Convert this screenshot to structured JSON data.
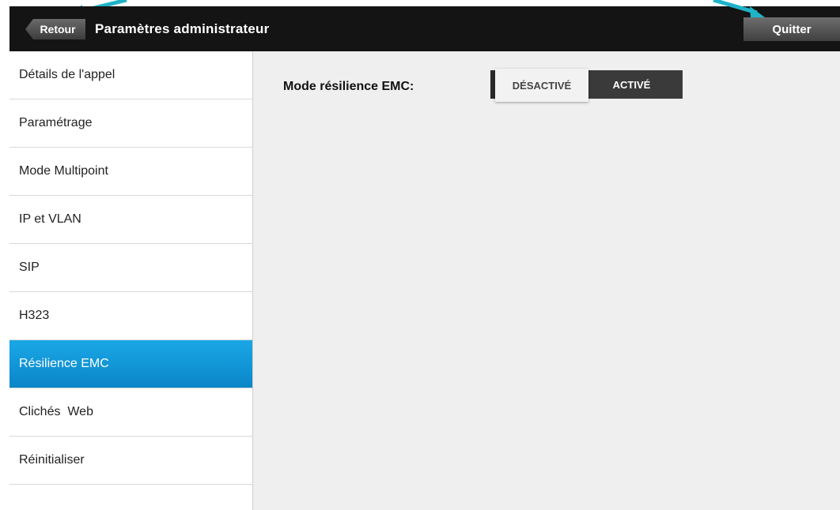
{
  "header": {
    "back_label": "Retour",
    "title": "Paramètres administrateur",
    "quit_label": "Quitter"
  },
  "sidebar": {
    "items": [
      {
        "label": "Détails de l'appel"
      },
      {
        "label": "Paramétrage"
      },
      {
        "label": "Mode Multipoint"
      },
      {
        "label": "IP et VLAN"
      },
      {
        "label": "SIP"
      },
      {
        "label": "H323"
      },
      {
        "label": "Résilience EMC"
      },
      {
        "label": "Clichés  Web"
      },
      {
        "label": "Réinitialiser"
      },
      {
        "label": ""
      }
    ],
    "active_index": 6
  },
  "main": {
    "setting_label": "Mode résilience EMC:",
    "toggle": {
      "off_label": "DÉSACTIVÉ",
      "on_label": "ACTIVÉ",
      "selected": "DÉSACTIVÉ"
    }
  },
  "colors": {
    "accent": "#0a86c8",
    "topbar": "#141414",
    "annotation_arrow": "#1fb3c8"
  }
}
